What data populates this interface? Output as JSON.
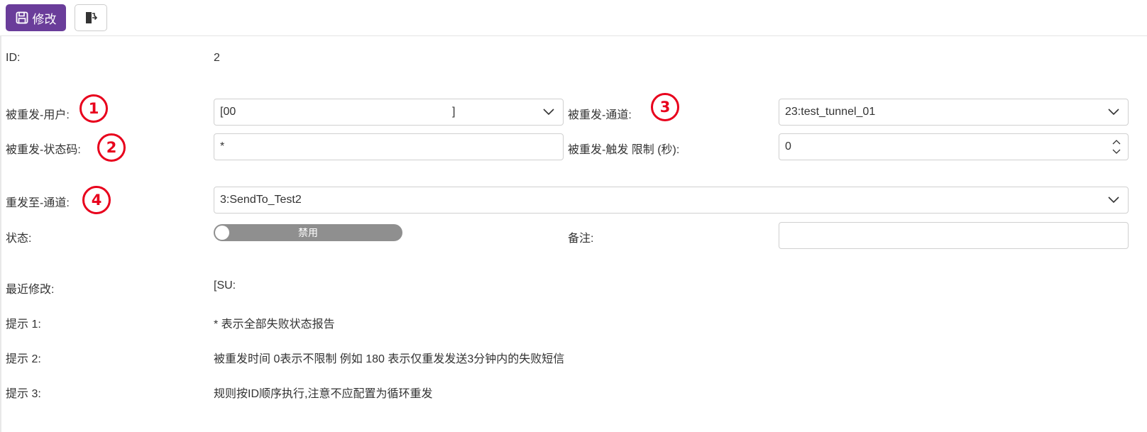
{
  "toolbar": {
    "save_label": "修改"
  },
  "form": {
    "id_label": "ID:",
    "id_value": "2",
    "user_label": "被重发-用户:",
    "user_value_left": "[00",
    "user_value_right": "]",
    "channel_label": "被重发-通道:",
    "channel_value": "23:test_tunnel_01",
    "status_code_label": "被重发-状态码:",
    "status_code_value": "*",
    "trigger_limit_label": "被重发-触发 限制 (秒):",
    "trigger_limit_value": "0",
    "resend_channel_label": "重发至-通道:",
    "resend_channel_value": "3:SendTo_Test2",
    "state_label": "状态:",
    "state_toggle_text": "禁用",
    "remark_label": "备注:",
    "remark_value": "",
    "last_modified_label": "最近修改:",
    "last_modified_value": "[SU:",
    "hint1_label": "提示 1:",
    "hint1_text": "* 表示全部失败状态报告",
    "hint2_label": "提示 2:",
    "hint2_text": "被重发时间 0表示不限制 例如 180 表示仅重发发送3分钟内的失败短信",
    "hint3_label": "提示 3:",
    "hint3_text": "规则按ID顺序执行,注意不应配置为循环重发"
  },
  "annotations": [
    "1",
    "2",
    "3",
    "4"
  ],
  "colors": {
    "primary": "#6a3d9a",
    "annotation": "#e8001c",
    "toggle_off": "#8f8f8f"
  },
  "icons": [
    "save-icon",
    "exit-icon",
    "chevron-down-icon",
    "spinner-icon"
  ]
}
